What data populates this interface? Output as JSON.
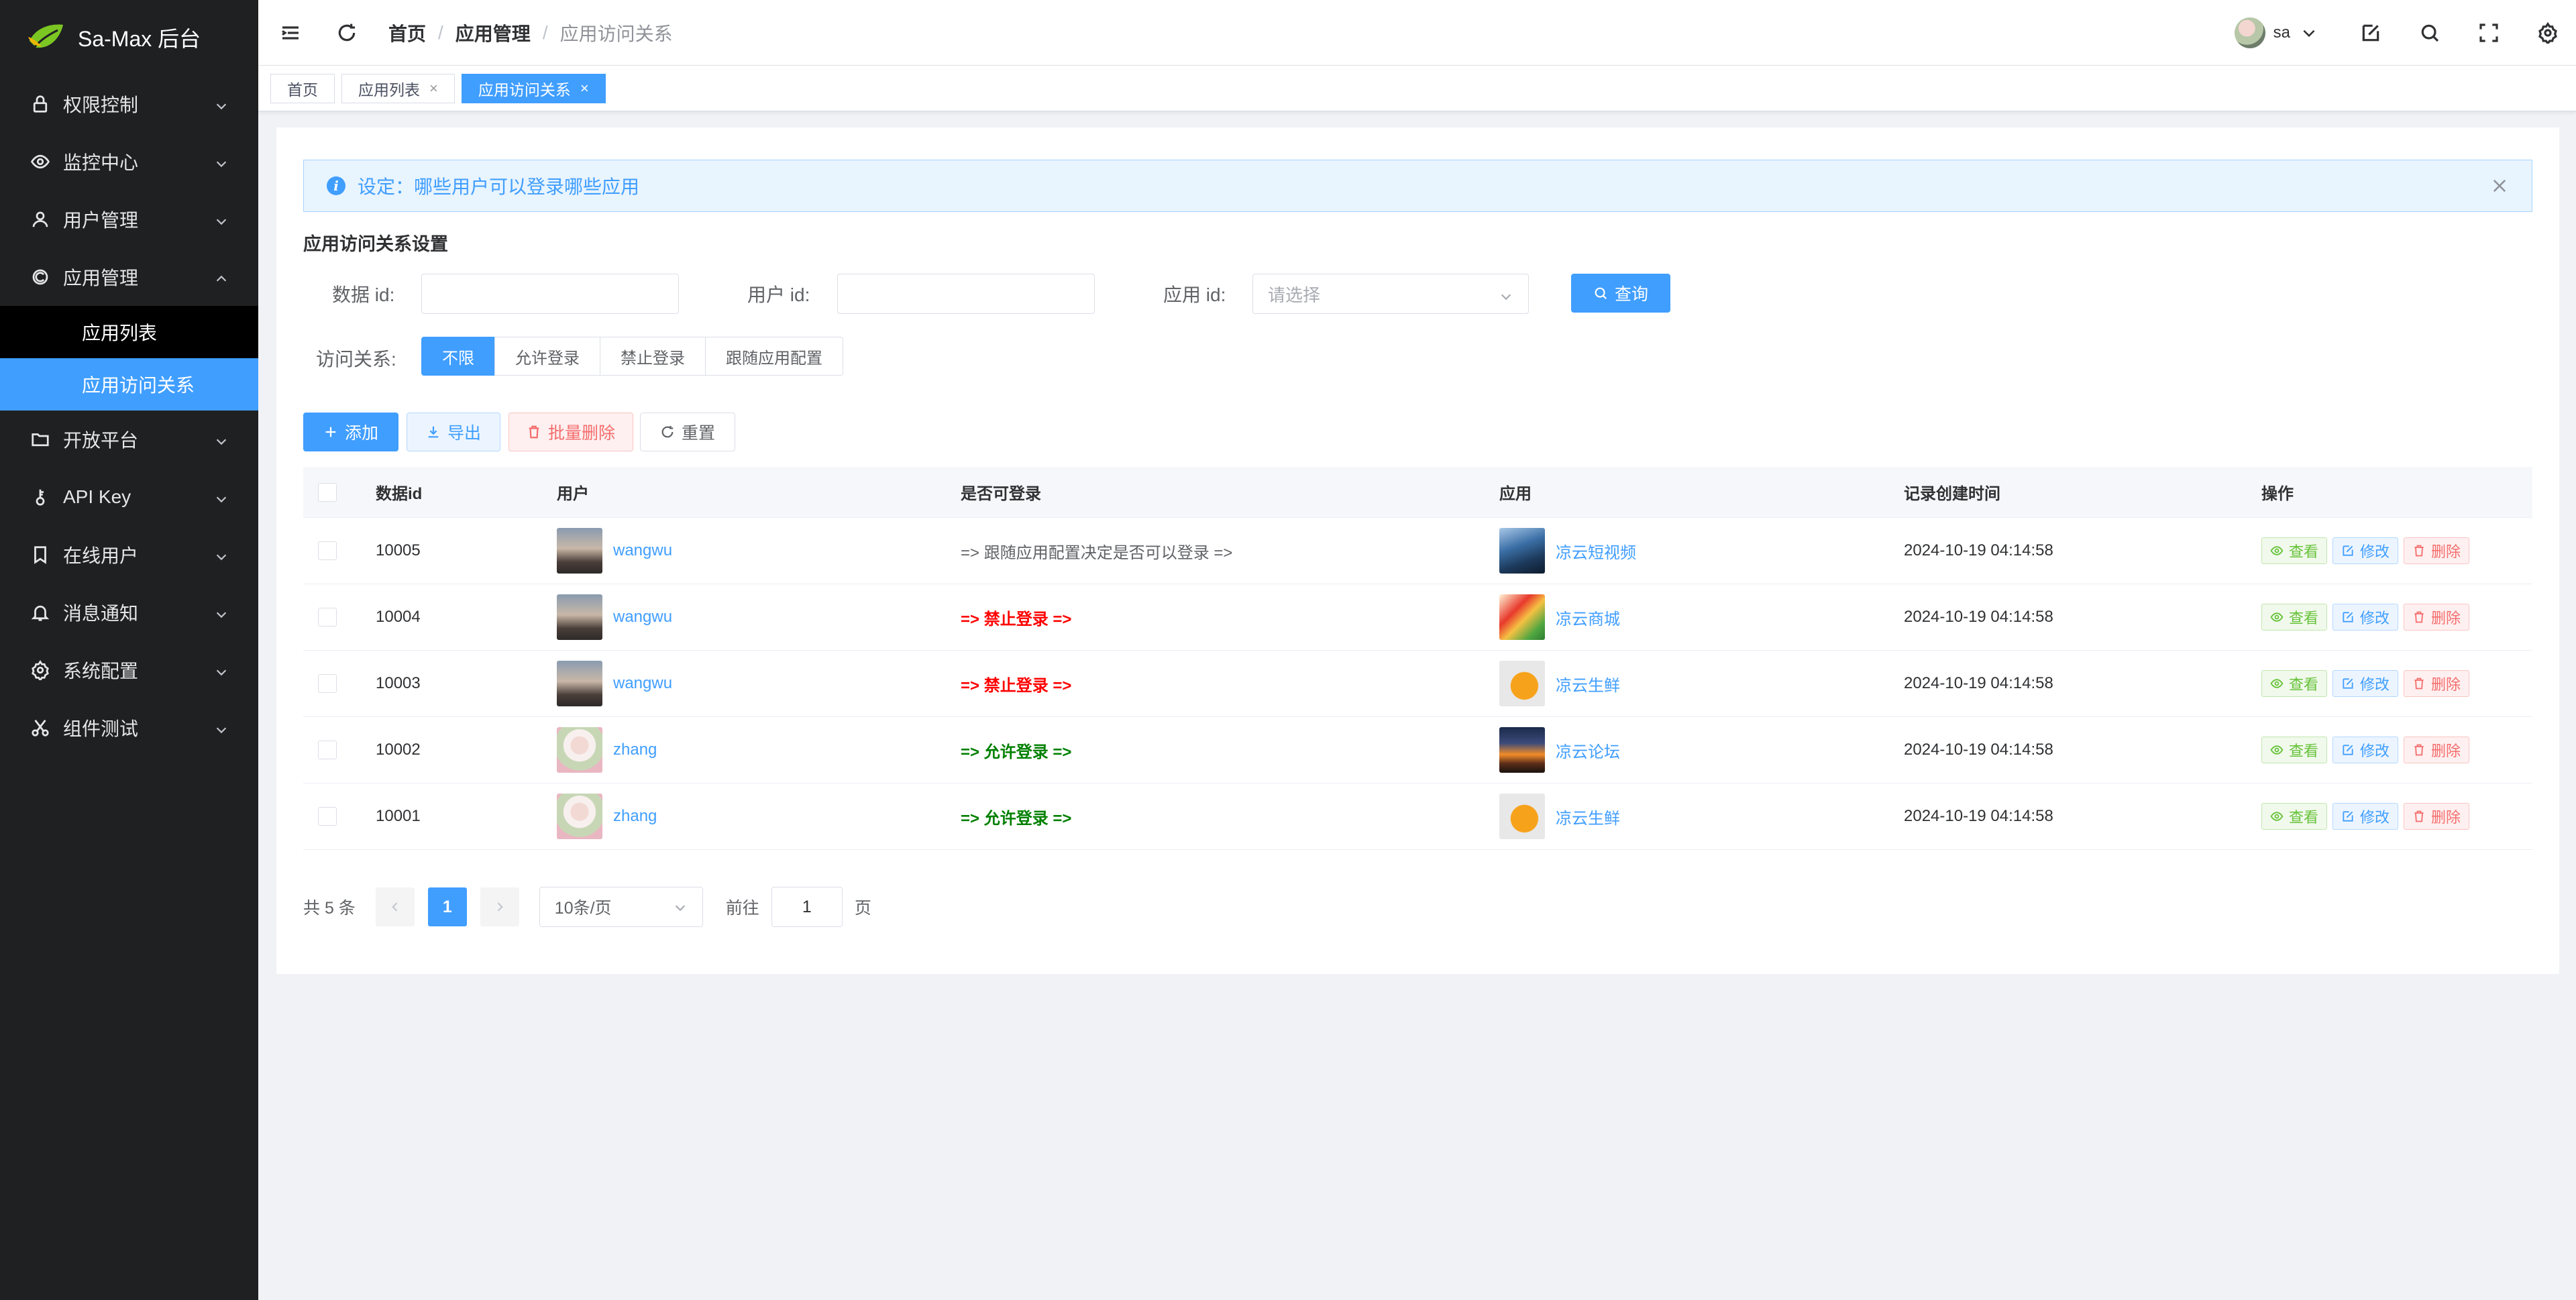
{
  "app": {
    "title": "Sa-Max 后台"
  },
  "sidebar": {
    "items": [
      {
        "label": "权限控制",
        "icon": "lock-icon",
        "expanded": false
      },
      {
        "label": "监控中心",
        "icon": "eye-icon",
        "expanded": false
      },
      {
        "label": "用户管理",
        "icon": "user-icon",
        "expanded": false
      },
      {
        "label": "应用管理",
        "icon": "app-icon",
        "expanded": true,
        "children": [
          {
            "label": "应用列表"
          },
          {
            "label": "应用访问关系",
            "active": true
          }
        ]
      },
      {
        "label": "开放平台",
        "icon": "folder-icon",
        "expanded": false
      },
      {
        "label": "API Key",
        "icon": "key-icon",
        "expanded": false
      },
      {
        "label": "在线用户",
        "icon": "bookmark-icon",
        "expanded": false
      },
      {
        "label": "消息通知",
        "icon": "bell-icon",
        "expanded": false
      },
      {
        "label": "系统配置",
        "icon": "gear-icon",
        "expanded": false
      },
      {
        "label": "组件测试",
        "icon": "scissors-icon",
        "expanded": false
      }
    ]
  },
  "header": {
    "breadcrumb": [
      "首页",
      "应用管理",
      "应用访问关系"
    ],
    "username": "sa"
  },
  "tabs": [
    {
      "label": "首页",
      "closable": false,
      "active": false
    },
    {
      "label": "应用列表",
      "closable": true,
      "active": false
    },
    {
      "label": "应用访问关系",
      "closable": true,
      "active": true
    }
  ],
  "alert": {
    "text": "设定：哪些用户可以登录哪些应用"
  },
  "form": {
    "section_title": "应用访问关系设置",
    "data_id_label": "数据 id:",
    "data_id_value": "",
    "user_id_label": "用户 id:",
    "user_id_value": "",
    "app_id_label": "应用 id:",
    "app_id_placeholder": "请选择",
    "query_label": "查询",
    "access_label": "访问关系:",
    "access_options": [
      "不限",
      "允许登录",
      "禁止登录",
      "跟随应用配置"
    ],
    "access_selected": "不限"
  },
  "toolbar": {
    "add_label": "添加",
    "export_label": "导出",
    "batch_delete_label": "批量删除",
    "reset_label": "重置"
  },
  "table": {
    "columns": [
      "数据id",
      "用户",
      "是否可登录",
      "应用",
      "记录创建时间",
      "操作"
    ],
    "ops": {
      "view": "查看",
      "edit": "修改",
      "delete": "删除"
    },
    "rows": [
      {
        "id": "10005",
        "user": "wangwu",
        "login": "=> 跟随应用配置决定是否可以登录 =>",
        "login_type": "follow",
        "app": "凉云短视频",
        "time": "2024-10-19 04:14:58"
      },
      {
        "id": "10004",
        "user": "wangwu",
        "login": "=> 禁止登录 =>",
        "login_type": "deny",
        "app": "凉云商城",
        "time": "2024-10-19 04:14:58"
      },
      {
        "id": "10003",
        "user": "wangwu",
        "login": "=> 禁止登录 =>",
        "login_type": "deny",
        "app": "凉云生鲜",
        "time": "2024-10-19 04:14:58"
      },
      {
        "id": "10002",
        "user": "zhang",
        "login": "=> 允许登录 =>",
        "login_type": "allow",
        "app": "凉云论坛",
        "time": "2024-10-19 04:14:58"
      },
      {
        "id": "10001",
        "user": "zhang",
        "login": "=> 允许登录 =>",
        "login_type": "allow",
        "app": "凉云生鲜",
        "time": "2024-10-19 04:14:58"
      }
    ]
  },
  "pagination": {
    "total_text": "共 5 条",
    "current_page": "1",
    "page_size": "10条/页",
    "goto_prefix": "前往",
    "goto_value": "1",
    "goto_suffix": "页"
  },
  "colors": {
    "primary": "#409eff",
    "sidebar_bg": "#1f2022",
    "deny": "#ff0000",
    "allow": "#008000",
    "follow": "#606266"
  }
}
